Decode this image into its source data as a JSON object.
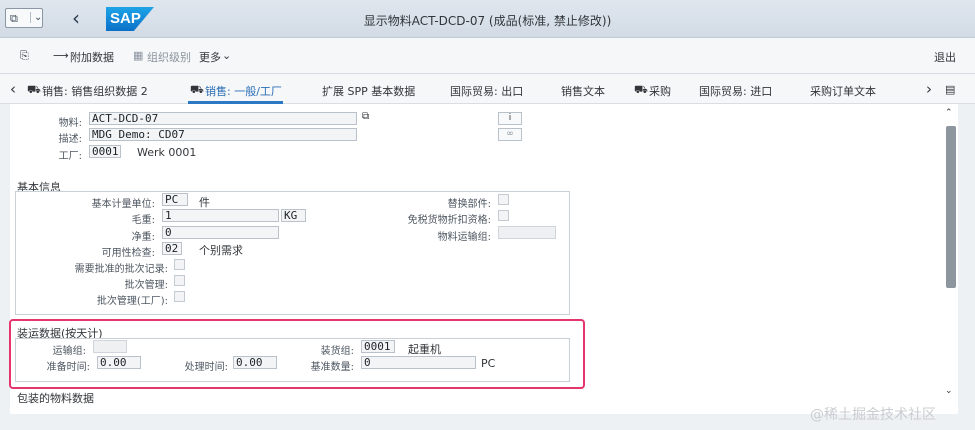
{
  "shell": {
    "title": "显示物料ACT-DCD-07 (成品(标准, 禁止修改))",
    "logo": "SAP",
    "back_icon": "‹"
  },
  "toolbar": {
    "attach": "附加数据",
    "org": "组织级别",
    "more": "更多",
    "exit": "退出"
  },
  "tabs": [
    "销售: 销售组织数据 2",
    "销售: 一般/工厂",
    "扩展 SPP 基本数据",
    "国际贸易: 出口",
    "销售文本",
    "采购",
    "国际贸易: 进口",
    "采购订单文本"
  ],
  "header": {
    "material_label": "物料:",
    "material_value": "ACT-DCD-07",
    "desc_label": "描述:",
    "desc_value": "MDG Demo: CD07",
    "plant_label": "工厂:",
    "plant_value": "0001",
    "plant_name": "Werk 0001"
  },
  "basic": {
    "title": "基本信息",
    "uom_label": "基本计量单位:",
    "uom_value": "PC",
    "uom_text": "件",
    "gross_label": "毛重:",
    "gross_value": "1",
    "gross_unit": "KG",
    "net_label": "净重:",
    "net_value": "0",
    "avail_label": "可用性检查:",
    "avail_value": "02",
    "avail_text": "个别需求",
    "batch_rec_label": "需要批准的批次记录:",
    "batch_mgmt_label": "批次管理:",
    "batch_mgmt_plant_label": "批次管理(工厂):",
    "replace_label": "替换部件:",
    "discount_label": "免税货物折扣资格:",
    "transport_label": "物料运输组:"
  },
  "shipping": {
    "title": "装运数据(按天计)",
    "trans_group_label": "运输组:",
    "loading_group_label": "装货组:",
    "loading_group_value": "0001",
    "loading_group_text": "起重机",
    "setup_label": "准备时间:",
    "setup_value": "0.00",
    "proc_label": "处理时间:",
    "proc_value": "0.00",
    "base_qty_label": "基准数量:",
    "base_qty_value": "0",
    "base_qty_unit": "PC"
  },
  "packaging": {
    "title": "包装的物料数据"
  },
  "watermark": "@稀土掘金技术社区",
  "colors": {
    "highlight": "#e5356c",
    "active_tab": "#2b6fb5"
  }
}
